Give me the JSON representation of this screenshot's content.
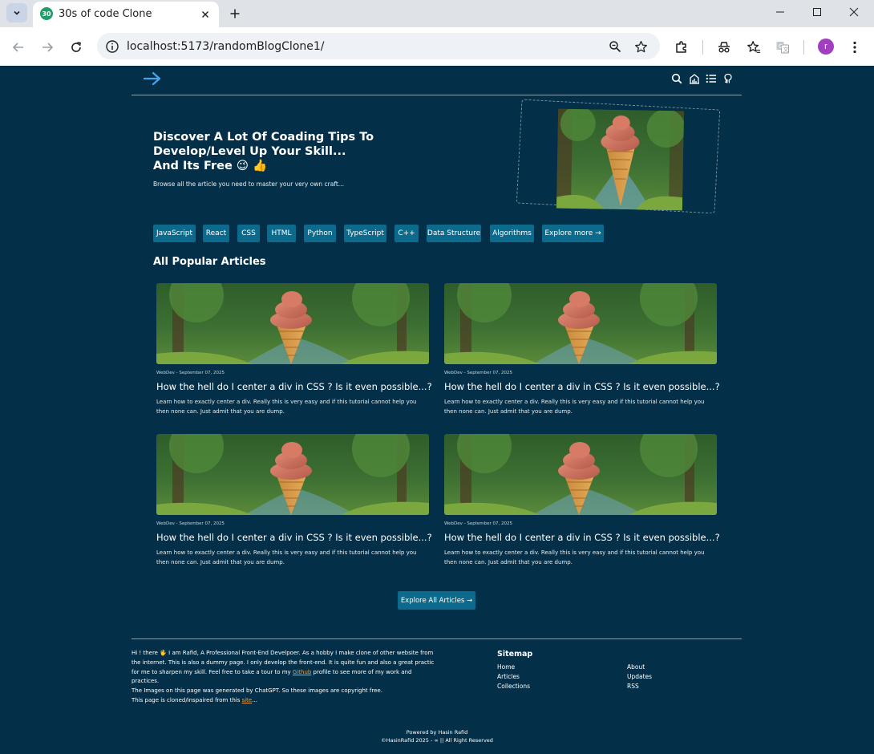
{
  "browser": {
    "tab_icon_text": "30",
    "tab_title": "30s of code Clone",
    "url": "localhost:5173/randomBlogClone1/",
    "profile_initial": "r"
  },
  "hero": {
    "title_line1": "Discover A Lot Of Coading Tips To",
    "title_line2": "Develop/Level Up Your Skill...",
    "title_line3": "And Its Free 😉 👍",
    "subtitle": "Browse all the article you need to master your very own craft..."
  },
  "tags": [
    "JavaScript",
    "React",
    "CSS",
    "HTML",
    "Python",
    "TypeScript",
    "C++",
    "Data Structure",
    "Algorithms",
    "Explore more →"
  ],
  "section_title": "All Popular Articles",
  "articles": [
    {
      "meta": "WebDev - September 07, 2025",
      "title": "How the hell do I center a div in CSS ? Is it even possible...?",
      "desc": "Learn how to exactly center a div. Really this is very easy and if this tutorial cannot help you then none can. Just admit that you are dump."
    },
    {
      "meta": "WebDev - September 07, 2025",
      "title": "How the hell do I center a div in CSS ? Is it even possible...?",
      "desc": "Learn how to exactly center a div. Really this is very easy and if this tutorial cannot help you then none can. Just admit that you are dump."
    },
    {
      "meta": "WebDev - September 07, 2025",
      "title": "How the hell do I center a div in CSS ? Is it even possible...?",
      "desc": "Learn how to exactly center a div. Really this is very easy and if this tutorial cannot help you then none can. Just admit that you are dump."
    },
    {
      "meta": "WebDev - September 07, 2025",
      "title": "How the hell do I center a div in CSS ? Is it even possible...?",
      "desc": "Learn how to exactly center a div. Really this is very easy and if this tutorial cannot help you then none can. Just admit that you are dump."
    }
  ],
  "explore_all": "Explore All Articles →",
  "footer": {
    "about_part1": "Hi ! there 🖐 I am Rafid, A Professional Front-End Develpoer. As a hobby I make clone of other website from the internet. This is also a dummy page. I only develop the front-end. It is quite fun and also a great practic for me to sharpen my skill. Feel free to take a tour to my ",
    "about_link1": "Github",
    "about_part2": " profile to see more of my work and practices.",
    "images_note": "The Images on this page was generated by ChatGPT. So these images are copyright free.",
    "cloned_part1": "This page is cloned/inspaired from this ",
    "cloned_link": "site",
    "cloned_part2": "...",
    "sitemap_title": "Sitemap",
    "sitemap_col1": [
      "Home",
      "Articles",
      "Collections"
    ],
    "sitemap_col2": [
      "About",
      "Updates",
      "RSS"
    ],
    "powered": "Powered by Hasin Rafid",
    "copyright": "©HasinRafid 2025 - ∞ || All Right Reserved"
  },
  "colors": {
    "page_bg": "#033048",
    "tag_bg": "#0c6b8c",
    "link_accent": "#e8a04a",
    "arrow_accent": "#4aa3e8"
  }
}
